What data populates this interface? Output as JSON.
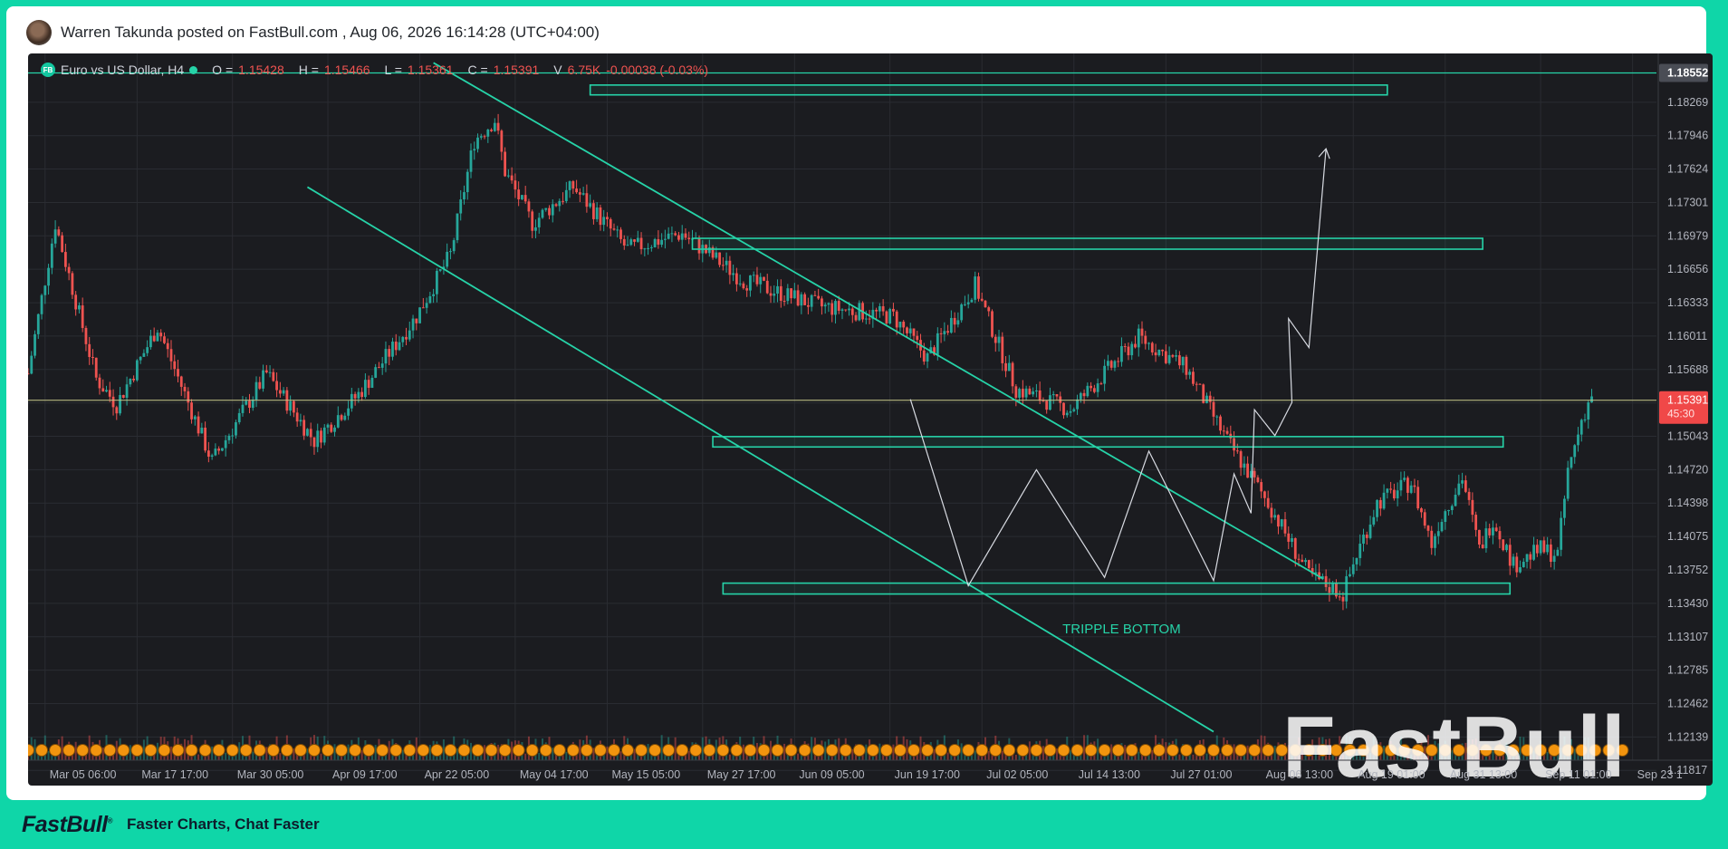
{
  "post": {
    "text": "Warren Takunda posted on FastBull.com ,  Aug 06, 2026 16:14:28 (UTC+04:00)"
  },
  "legend": {
    "symbol": "Euro vs US Dollar, H4",
    "o_label": "O =",
    "o_value": "1.15428",
    "h_label": "H =",
    "h_value": "1.15466",
    "l_label": "L =",
    "l_value": "1.15361",
    "c_label": "C =",
    "c_value": "1.15391",
    "v_label": "V",
    "v_value": "6.75K",
    "change": "-0.00038 (-0.03%)"
  },
  "colors": {
    "up": "#26a69a",
    "down": "#ef5350",
    "drawing": "#26d3a8",
    "price_line": "#c9c98a",
    "price_badge": "#f04848",
    "volume_marker": "#f2940e"
  },
  "chart_data": {
    "type": "candlestick",
    "symbol": "Euro vs US Dollar",
    "timeframe": "H4",
    "y_ticks": [
      "1.18552",
      "1.18269",
      "1.17946",
      "1.17624",
      "1.17301",
      "1.16979",
      "1.16656",
      "1.16333",
      "1.16011",
      "1.15688",
      "1.15365",
      "1.15043",
      "1.14720",
      "1.14398",
      "1.14075",
      "1.13752",
      "1.13430",
      "1.13107",
      "1.12785",
      "1.12462",
      "1.12139",
      "1.11817"
    ],
    "ylim": [
      1.1167,
      1.1874
    ],
    "x_ticks": [
      "Mar 05 06:00",
      "Mar 17 17:00",
      "Mar 30 05:00",
      "Apr 09 17:00",
      "Apr 22 05:00",
      "May 04 17:00",
      "May 15 05:00",
      "May 27 17:00",
      "Jun 09 05:00",
      "Jun 19 17:00",
      "Jul 02 05:00",
      "Jul 14 13:00",
      "Jul 27 01:00",
      "Aug 06 13:00",
      "Aug 19 01:00",
      "Aug 31 13:00",
      "Sep 11 01:00",
      "Sep 23 1"
    ],
    "current_price": "1.15391",
    "countdown": "45:30",
    "top_badge": "1.18552",
    "trend_path_x": [
      0,
      8,
      20,
      26,
      38,
      54,
      70,
      84,
      97,
      114,
      124,
      131,
      137,
      140,
      148,
      160,
      176,
      192,
      210,
      232,
      254,
      264,
      278,
      290,
      306,
      326,
      340,
      352,
      364,
      376,
      386,
      390,
      396,
      406,
      412,
      414,
      421,
      426,
      430,
      436,
      444,
      449,
      452,
      456,
      459
    ],
    "trend_path_y": [
      1.1565,
      1.171,
      1.156,
      1.1535,
      1.161,
      1.148,
      1.1565,
      1.15,
      1.1545,
      1.162,
      1.168,
      1.179,
      1.181,
      1.176,
      1.171,
      1.1745,
      1.1685,
      1.17,
      1.1655,
      1.163,
      1.162,
      1.158,
      1.165,
      1.155,
      1.153,
      1.16,
      1.157,
      1.15,
      1.144,
      1.137,
      1.1352,
      1.139,
      1.144,
      1.146,
      1.14,
      1.142,
      1.1465,
      1.1395,
      1.1425,
      1.138,
      1.1395,
      1.139,
      1.147,
      1.152,
      1.1545
    ],
    "channel_upper": [
      [
        119,
        1.1865
      ],
      [
        380,
        1.1367
      ]
    ],
    "channel_lower": [
      [
        82,
        1.1745
      ],
      [
        348,
        1.1219
      ]
    ],
    "zones": [
      {
        "x0": 165,
        "x1": 399,
        "y0": 1.18435,
        "y1": 1.1834
      },
      {
        "x0": 195,
        "x1": 427,
        "y0": 1.16955,
        "y1": 1.1685
      },
      {
        "x0": 201,
        "x1": 433,
        "y0": 1.1504,
        "y1": 1.1494
      },
      {
        "x0": 204,
        "x1": 435,
        "y0": 1.13625,
        "y1": 1.1352
      }
    ],
    "zigzag": [
      [
        259,
        1.154
      ],
      [
        276,
        1.136
      ],
      [
        296,
        1.1472
      ],
      [
        316,
        1.1368
      ],
      [
        329,
        1.149
      ],
      [
        348,
        1.1365
      ],
      [
        354,
        1.1468
      ],
      [
        359,
        1.143
      ],
      [
        360,
        1.153
      ],
      [
        366,
        1.1505
      ],
      [
        371,
        1.1537
      ],
      [
        370,
        1.1618
      ],
      [
        376,
        1.159
      ],
      [
        381,
        1.1782
      ]
    ],
    "annotations": [
      "TRIPPLE BOTTOM"
    ],
    "annotation_at": [
      [
        321,
        1.1314
      ]
    ],
    "x_index_range": [
      0,
      478
    ],
    "label_positions": [
      5,
      32,
      60,
      88,
      115,
      143,
      170,
      198,
      225,
      253,
      280,
      307,
      334,
      362,
      389,
      416,
      444,
      471
    ]
  },
  "watermark": "FastBull",
  "footer": {
    "logo": "FastBull",
    "trademark": "®",
    "tagline": "Faster Charts, Chat Faster"
  }
}
